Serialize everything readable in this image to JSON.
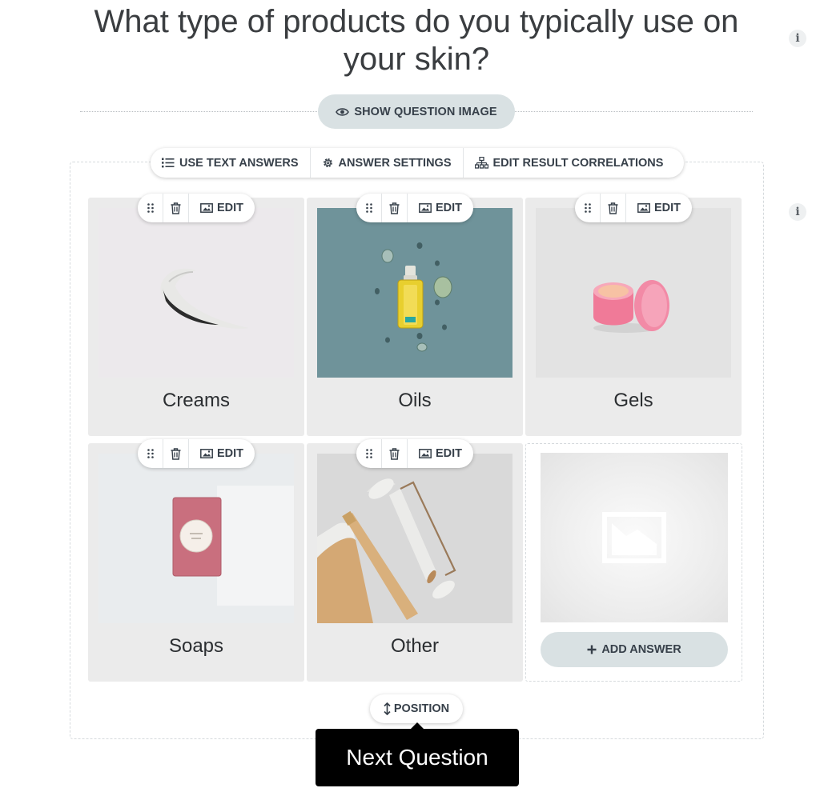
{
  "question": {
    "title": "What type of products do you typically use on your skin?",
    "info_icon_glyph": "i",
    "show_image_label": "SHOW QUESTION IMAGE"
  },
  "answer_toolbar": {
    "use_text_answers": "USE TEXT ANSWERS",
    "answer_settings": "ANSWER SETTINGS",
    "edit_result_correlations": "EDIT RESULT CORRELATIONS"
  },
  "card_toolbar": {
    "edit_label": "EDIT"
  },
  "answers": [
    {
      "label": "Creams"
    },
    {
      "label": "Oils"
    },
    {
      "label": "Gels"
    },
    {
      "label": "Soaps"
    },
    {
      "label": "Other"
    }
  ],
  "add_answer": {
    "label": "ADD ANSWER",
    "icon": "plus-icon"
  },
  "position": {
    "label": "POSITION",
    "icon": "vertical-arrows-icon"
  },
  "next_question": {
    "label": "Next Question"
  },
  "colors": {
    "pill_bg": "#d9e1e3",
    "card_bg": "#ebebeb",
    "button_dark": "#000000"
  }
}
